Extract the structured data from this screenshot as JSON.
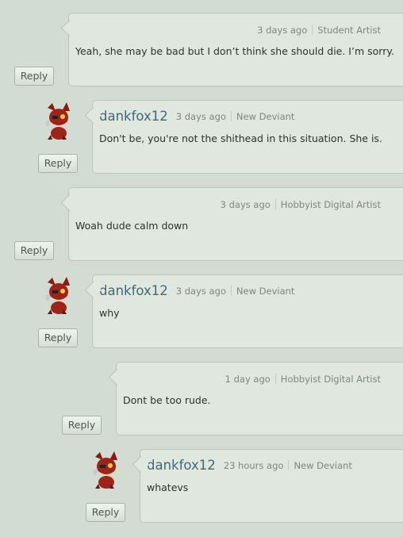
{
  "comments": [
    {
      "time": "3 days ago",
      "role": "Student Artist",
      "text": "Yeah, she may be bad but I don’t think she should die. I’m sorry.",
      "reply": "Reply"
    },
    {
      "username": "dankfox12",
      "time": "3 days ago",
      "role": "New Deviant",
      "text": "Don't be, you're not the shithead in this situation. She is.",
      "reply": "Reply"
    },
    {
      "time": "3 days ago",
      "role": "Hobbyist Digital Artist",
      "text": "Woah dude calm down",
      "reply": "Reply"
    },
    {
      "username": "dankfox12",
      "time": "3 days ago",
      "role": "New Deviant",
      "text": "why",
      "reply": "Reply"
    },
    {
      "time": "1 day ago",
      "role": "Hobbyist Digital Artist",
      "text": "Dont be too rude.",
      "reply": "Reply"
    },
    {
      "username": "dankfox12",
      "time": "23 hours ago",
      "role": "New Deviant",
      "text": "whatevs",
      "reply": "Reply"
    }
  ],
  "colors": {
    "background": "#d2dcd2",
    "bubble": "#dfe7df",
    "username": "#3c6a78"
  },
  "icons": {
    "avatar": "foxy-avatar-icon"
  }
}
